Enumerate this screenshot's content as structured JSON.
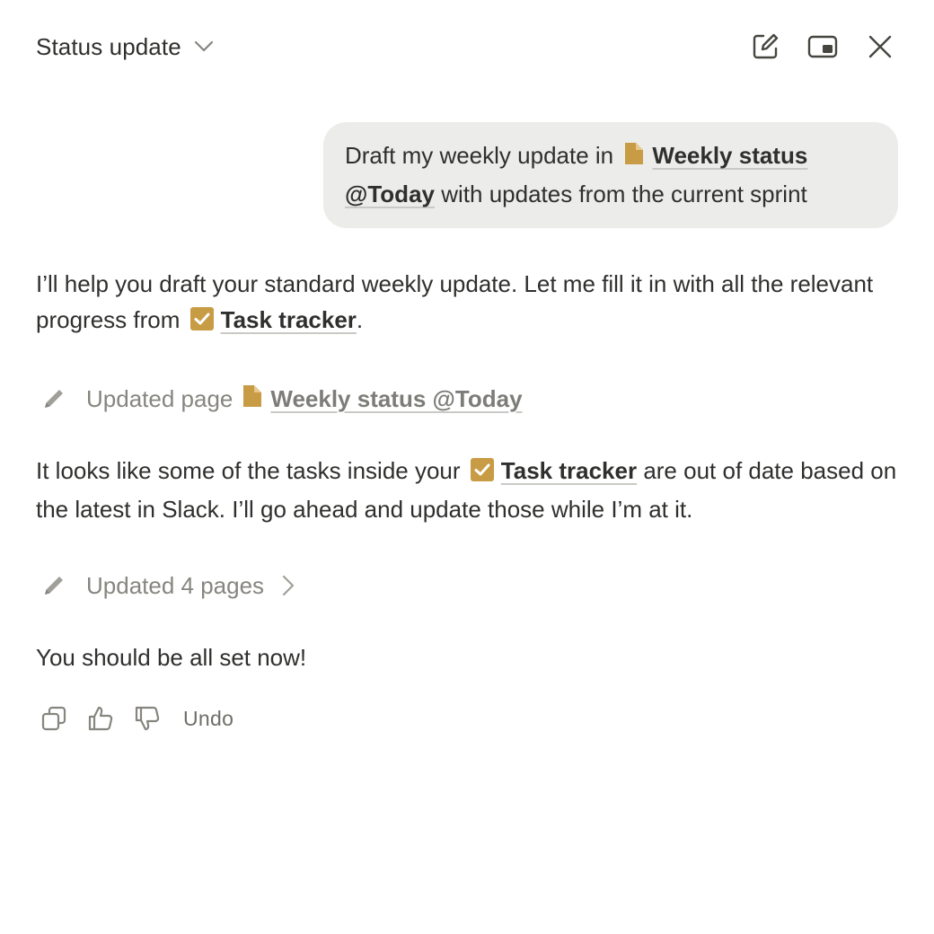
{
  "header": {
    "title": "Status update",
    "icons": [
      "new-chat-icon",
      "picture-in-picture-icon",
      "close-icon"
    ]
  },
  "user_message": {
    "prefix": "Draft my weekly update in",
    "mention": "Weekly status @Today",
    "mention_icon": "document-icon",
    "suffix": "with updates from the current sprint"
  },
  "assistant": {
    "para1": {
      "text": "I’ll help you draft your standard weekly update. Let me fill it in with all the relevant progress from",
      "mention": "Task tracker",
      "mention_icon": "checkbox-icon",
      "end": "."
    },
    "action1": {
      "icon": "pencil-icon",
      "label": "Updated page",
      "mention": "Weekly status @Today",
      "mention_icon": "document-icon"
    },
    "para2": {
      "before": "It looks like some of the tasks inside your",
      "mention": "Task tracker",
      "mention_icon": "checkbox-icon",
      "after": "are out of date based on the latest in Slack. I’ll go ahead and update those while I’m at it."
    },
    "action2": {
      "icon": "pencil-icon",
      "label": "Updated 4 pages",
      "chevron_icon": "chevron-right-icon"
    },
    "para3": "You should be all set now!"
  },
  "feedback": {
    "icons": [
      "copy-icon",
      "thumbs-up-icon",
      "thumbs-down-icon"
    ],
    "undo_label": "Undo"
  },
  "colors": {
    "accent_mention_icon": "#c89b45",
    "bubble_bg": "#ececea",
    "text": "#2f2f2d",
    "muted": "#86857f"
  }
}
